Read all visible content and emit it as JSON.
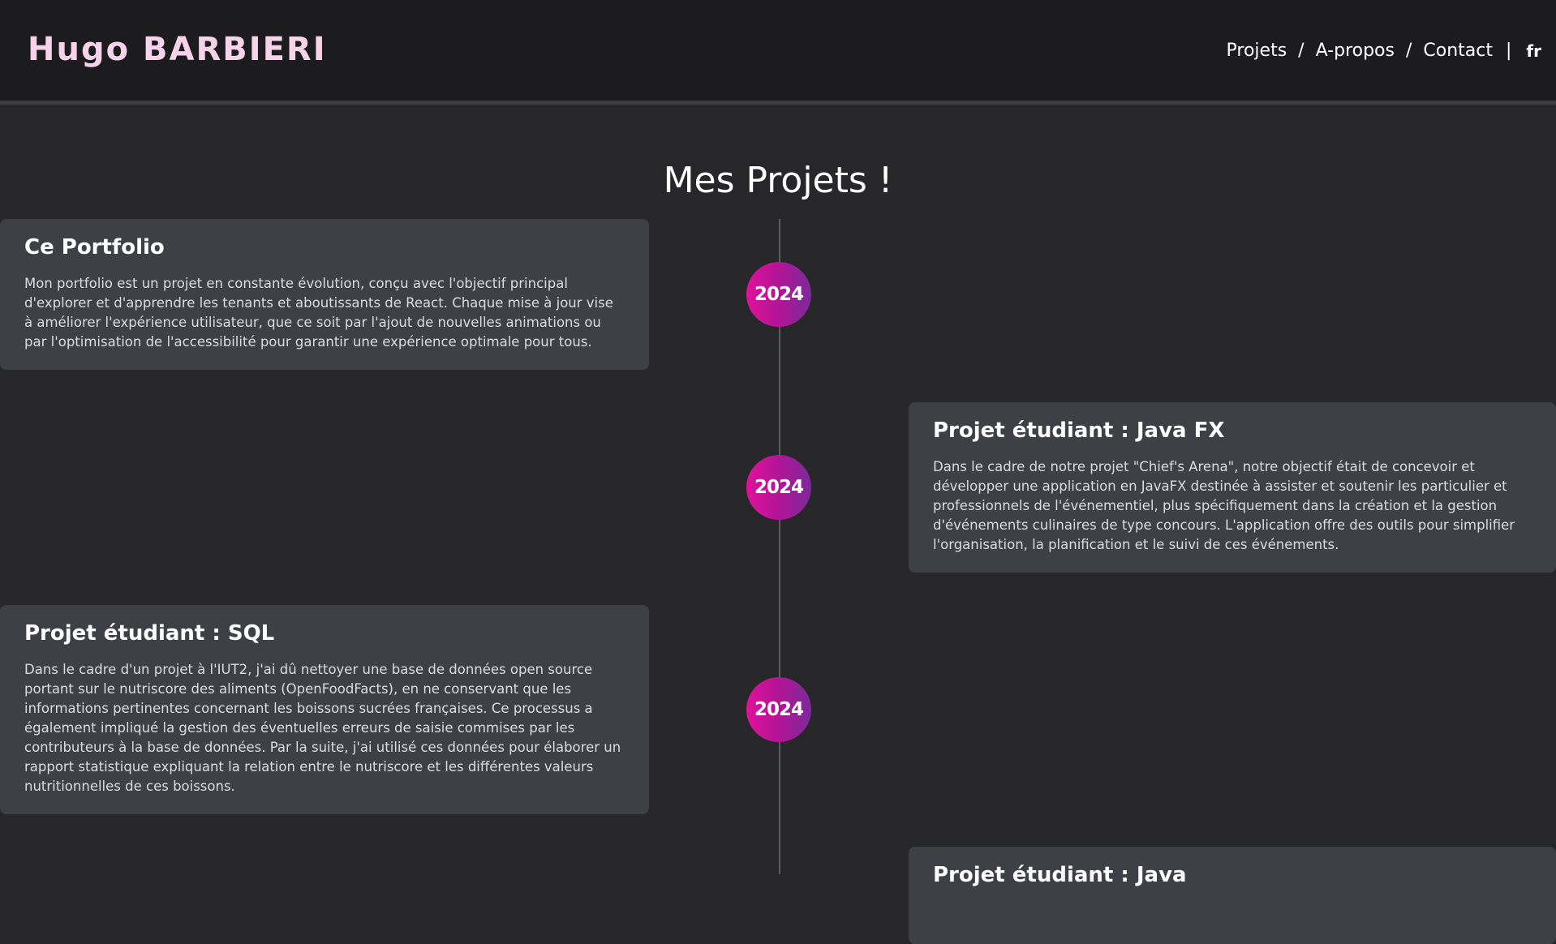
{
  "header": {
    "logo": "Hugo BARBIERI",
    "nav": {
      "projets": "Projets",
      "sep1": "/",
      "apropos": "A-propos",
      "sep2": "/",
      "contact": "Contact",
      "divider": "|",
      "lang": "fr"
    }
  },
  "main": {
    "title": "Mes Projets !",
    "timeline": [
      {
        "year": "2024",
        "title": "Ce Portfolio",
        "description": "Mon portfolio est un projet en constante évolution, conçu avec l'objectif principal d'explorer et d'apprendre les tenants et aboutissants de React. Chaque mise à jour vise à améliorer l'expérience utilisateur, que ce soit par l'ajout de nouvelles animations ou par l'optimisation de l'accessibilité pour garantir une expérience optimale pour tous."
      },
      {
        "year": "2024",
        "title": "Projet étudiant : Java FX",
        "description": "Dans le cadre de notre projet \"Chief's Arena\", notre objectif était de concevoir et développer une application en JavaFX destinée à assister et soutenir les particulier et professionnels de l'événementiel, plus spécifiquement dans la création et la gestion d'événements culinaires de type concours. L'application offre des outils pour simplifier l'organisation, la planification et le suivi de ces événements."
      },
      {
        "year": "2024",
        "title": "Projet étudiant : SQL",
        "description": "Dans le cadre d'un projet à l'IUT2, j'ai dû nettoyer une base de données open source portant sur le nutriscore des aliments (OpenFoodFacts), en ne conservant que les informations pertinentes concernant les boissons sucrées françaises. Ce processus a également impliqué la gestion des éventuelles erreurs de saisie commises par les contributeurs à la base de données. Par la suite, j'ai utilisé ces données pour élaborer un rapport statistique expliquant la relation entre le nutriscore et les différentes valeurs nutritionnelles de ces boissons."
      },
      {
        "title": "Projet étudiant : Java"
      }
    ]
  },
  "colors": {
    "background": "#27272a",
    "header": "#1c1c1e",
    "card": "#3f3f46",
    "logo": "#f6d3ea",
    "badge_gradient": [
      "#e0119a",
      "#7b2a9a"
    ]
  }
}
